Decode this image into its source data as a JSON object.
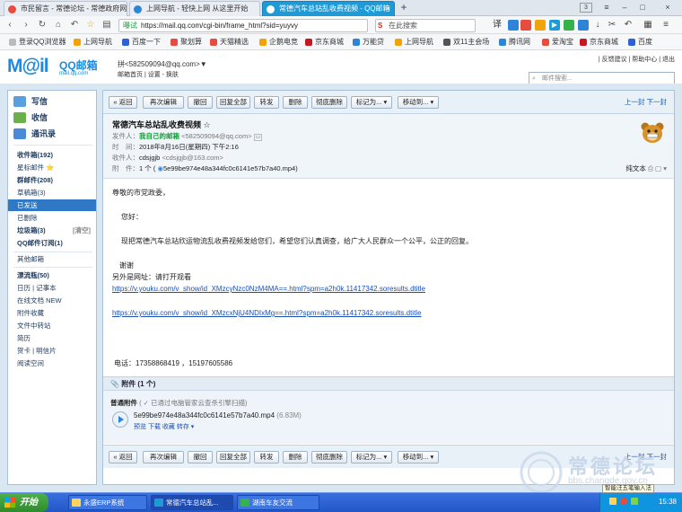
{
  "browser": {
    "tabs": [
      {
        "label": "市民留言 - 常德论坛 - 常德政府网",
        "active": false
      },
      {
        "label": "上网导航 - 轻快上网 从这里开始",
        "active": false
      },
      {
        "label": "常德汽车总站乱收费视频 - QQ邮箱",
        "active": true
      }
    ],
    "new_tab": "+",
    "tab_count": "3",
    "address_security": "曝试",
    "address_url": "https://mail.qq.com/cgi-bin/frame_html?sid=yuyvy",
    "search_placeholder": "在此搜索",
    "bookmarks": [
      "登录QQ浏览器",
      "上网导航",
      "百度一下",
      "聚划算",
      "天猫精选",
      "企鹅电竞",
      "京东商城",
      "万能贷",
      "上网导航",
      "双11主会场",
      "腾讯网",
      "爱淘宝",
      "京东商城",
      "百度"
    ]
  },
  "mail_header": {
    "logo_main": "M@il",
    "logo_brand": "QQ邮箱",
    "logo_url": "mail.qq.com",
    "user": "拼<582509094@qq.com>▼",
    "user_links": "邮箱首页 | 设置 - 换肤",
    "top_links": "| 反馈建议 | 帮助中心 | 退出",
    "search_placeholder": "邮件搜索..."
  },
  "sidebar": {
    "write": "写信",
    "receive": "收信",
    "contacts": "通讯录",
    "folders": [
      {
        "label": "收件箱(192)",
        "bold": true
      },
      {
        "label": "星标邮件 ⭐",
        "bold": false
      },
      {
        "label": "群邮件(208)",
        "bold": true
      },
      {
        "label": "草稿箱(3)",
        "bold": false
      },
      {
        "label": "已发送",
        "bold": false,
        "selected": true
      },
      {
        "label": "已删除",
        "bold": false
      },
      {
        "label": "垃圾箱(3)",
        "bold": true,
        "right": "[清空]"
      },
      {
        "label": "QQ邮件订阅(1)",
        "bold": true
      }
    ],
    "other": "其他邮箱",
    "apps": [
      {
        "label": "漂流瓶(50)",
        "bold": true
      },
      {
        "label": "日历 | 记事本",
        "bold": false
      },
      {
        "label": "在线文档 NEW",
        "bold": false
      },
      {
        "label": "附件收藏",
        "bold": false
      },
      {
        "label": "文件中转站",
        "bold": false
      },
      {
        "label": "简历",
        "bold": false
      },
      {
        "label": "贺卡 | 明信片",
        "bold": false
      },
      {
        "label": "阅读空间",
        "bold": false
      }
    ]
  },
  "toolbar": {
    "buttons": [
      "« 返回",
      "再次编辑",
      "撤回",
      "回复全部",
      "转发",
      "删除",
      "彻底删除",
      "标记为... ▾",
      "移动到... ▾"
    ],
    "prev_next": "上一封 下一封"
  },
  "email": {
    "subject": "常德汽车总站乱收费视频 ☆",
    "from_label": "发件人：",
    "from_name": "我自己的邮箱",
    "from_addr": "<582509094@qq.com>",
    "time_label": "时　间：",
    "time": "2018年8月16日(星期四) 下午2:16",
    "to_label": "收件人：",
    "to_name": "cdsjgjb",
    "to_addr": "<cdsjgjb@163.com>",
    "att_label": "附　件：",
    "att_summary": "1 个 (",
    "att_file": "5e99be974e48a344fc0c6141e57b7a40.mp4",
    "att_tail": ")",
    "view_options": "纯文本"
  },
  "body": {
    "greeting": "尊敬的市党政委，",
    "hello": "您好：",
    "p1": "现把常德汽车总站欣运物流乱收费视频发给您们，希望您们认真调查，给广大人民群众一个公平，公正的回复。",
    "thanks": "谢谢",
    "addr_note": "另外是网址：请打开观看",
    "link1": "https://v.youku.com/v_show/id_XMzcyNzc0NzM4MA==.html?spm=a2h0k.11417342.soresults.dtitle",
    "link2": "https://v.youku.com/v_show/id_XMzcxNjU4NDIxMg==.html?spm=a2h0k.11417342.soresults.dtitle",
    "phone": "电话：17358868419 ，15197605586"
  },
  "attachment": {
    "header": "附件 (1 个)",
    "kind": "普通附件",
    "scan_note": "( ✓ 已通过电脑管家云查杀引擎扫描)",
    "filename": "5e99be974e48a344fc0c6141e57b7a40.mp4",
    "size": "(6.83M)",
    "actions": "预览  下载  收藏  转存 ▾"
  },
  "taskbar": {
    "start": "开始",
    "tasks": [
      "永盛ERP系统",
      "常德汽车总站乱...",
      "湖南车友交流"
    ],
    "clock": "15:38",
    "ime": "智能汪五笔输入法"
  },
  "watermark": {
    "text": "常德论坛",
    "url": "bbs.changde.gov.cn"
  },
  "colors": {
    "accent": "#1e9ad6",
    "selected_folder": "#2e78c5",
    "link": "#1a4fb5",
    "start_green": "#2f8b2c"
  }
}
